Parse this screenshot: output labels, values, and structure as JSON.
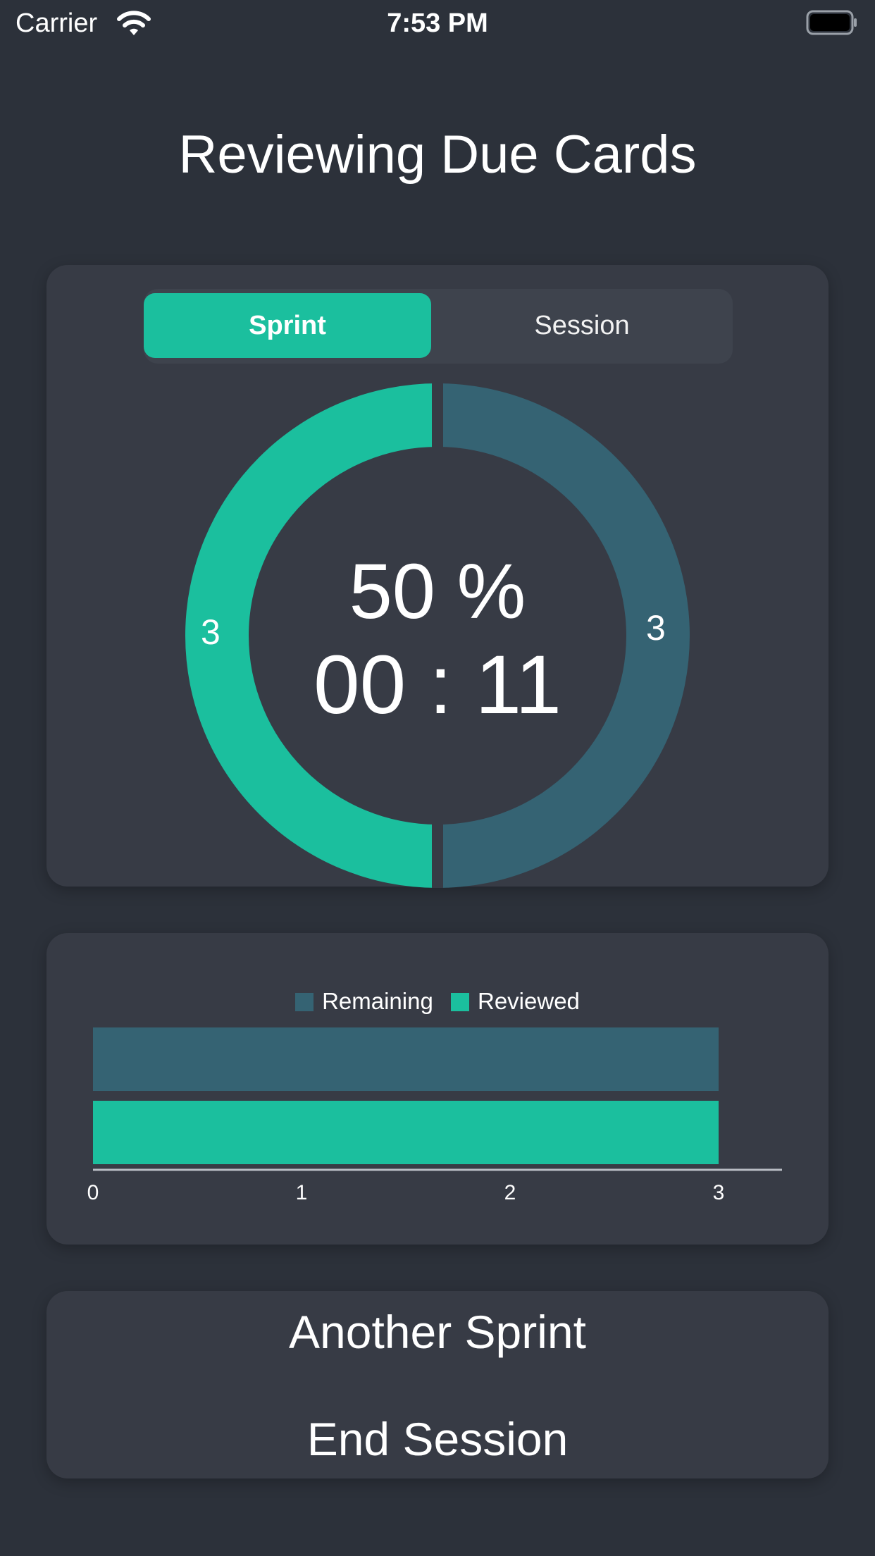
{
  "status_bar": {
    "carrier": "Carrier",
    "time": "7:53 PM",
    "icons": [
      "wifi-icon",
      "battery-icon"
    ]
  },
  "title": "Reviewing Due Cards",
  "segmented_control": {
    "options": [
      "Sprint",
      "Session"
    ],
    "selected": "Sprint"
  },
  "progress": {
    "percent_text": "50 %",
    "timer_text": "00 : 11",
    "reviewed_count": "3",
    "remaining_count": "3"
  },
  "colors": {
    "background": "#2c313a",
    "card": "#373b45",
    "reviewed": "#1bbf9e",
    "remaining": "#356373",
    "segment_track": "#3e434d"
  },
  "chart_data": [
    {
      "type": "pie",
      "labels": [
        "Reviewed",
        "Remaining"
      ],
      "values": [
        3,
        3
      ],
      "center_text": [
        "50 %",
        "00 : 11"
      ]
    },
    {
      "type": "bar",
      "orientation": "horizontal",
      "legend": [
        "Remaining",
        "Reviewed"
      ],
      "legend_placement": "top-center",
      "series": [
        {
          "name": "Remaining",
          "values": [
            3
          ]
        },
        {
          "name": "Reviewed",
          "values": [
            3
          ]
        }
      ],
      "xlim": [
        0,
        3
      ],
      "x_ticks": [
        "0",
        "1",
        "2",
        "3"
      ],
      "grid": false
    }
  ],
  "actions": {
    "another_sprint": "Another Sprint",
    "end_session": "End Session"
  }
}
